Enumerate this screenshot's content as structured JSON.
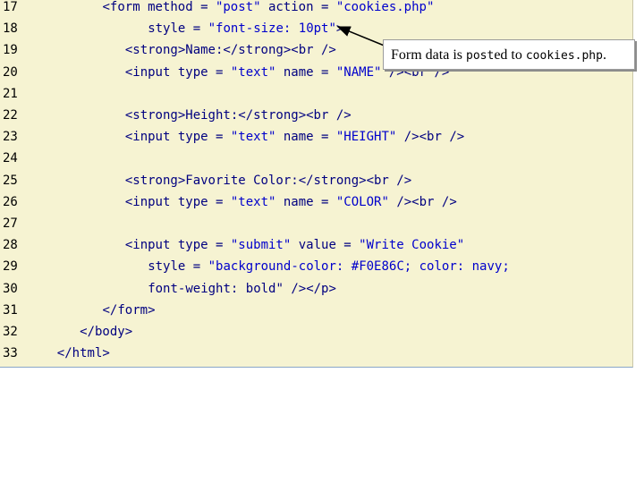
{
  "code": {
    "lines": [
      {
        "num": "17",
        "indent": 10,
        "parts": [
          "<form method = ",
          "\"post\"",
          " action = ",
          "\"cookies.php\""
        ]
      },
      {
        "num": "18",
        "indent": 16,
        "parts": [
          "style = ",
          "\"font-size: 10pt\"",
          ">"
        ]
      },
      {
        "num": "19",
        "indent": 13,
        "parts": [
          "<strong>Name:</strong><br />"
        ]
      },
      {
        "num": "20",
        "indent": 13,
        "parts": [
          "<input type = ",
          "\"text\"",
          " name = ",
          "\"NAME\"",
          " /><br />"
        ]
      },
      {
        "num": "21",
        "indent": 0,
        "parts": [
          ""
        ]
      },
      {
        "num": "22",
        "indent": 13,
        "parts": [
          "<strong>Height:</strong><br />"
        ]
      },
      {
        "num": "23",
        "indent": 13,
        "parts": [
          "<input type = ",
          "\"text\"",
          " name = ",
          "\"HEIGHT\"",
          " /><br />"
        ]
      },
      {
        "num": "24",
        "indent": 0,
        "parts": [
          ""
        ]
      },
      {
        "num": "25",
        "indent": 13,
        "parts": [
          "<strong>Favorite Color:</strong><br />"
        ]
      },
      {
        "num": "26",
        "indent": 13,
        "parts": [
          "<input type = ",
          "\"text\"",
          " name = ",
          "\"COLOR\"",
          " /><br />"
        ]
      },
      {
        "num": "27",
        "indent": 0,
        "parts": [
          ""
        ]
      },
      {
        "num": "28",
        "indent": 13,
        "parts": [
          "<input type = ",
          "\"submit\"",
          " value = ",
          "\"Write Cookie\""
        ]
      },
      {
        "num": "29",
        "indent": 16,
        "parts": [
          "style = ",
          "\"background-color: #F0E86C; color: navy;"
        ]
      },
      {
        "num": "30",
        "indent": 16,
        "parts": [
          "font-weight: bold\"",
          " /></p>"
        ]
      },
      {
        "num": "31",
        "indent": 10,
        "parts": [
          "</form>"
        ]
      },
      {
        "num": "32",
        "indent": 7,
        "parts": [
          "</body>"
        ]
      },
      {
        "num": "33",
        "indent": 4,
        "parts": [
          "</html>"
        ]
      }
    ]
  },
  "callout": {
    "pre": "Form data is ",
    "mono1": "post",
    "mid": "ed to ",
    "mono2": "cookies.php",
    "post": "."
  },
  "colors": {
    "panel_bg": "#f6f3d2",
    "code_text": "#000080",
    "string_text": "#0000cc",
    "line_number": "#000000"
  }
}
